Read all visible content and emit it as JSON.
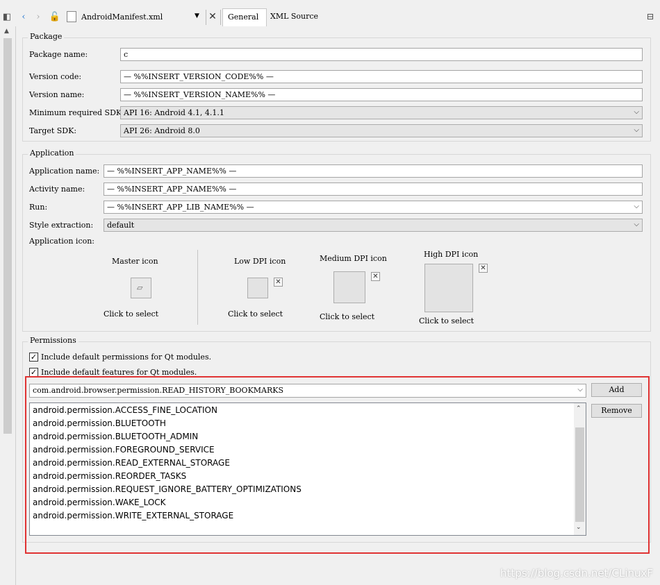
{
  "toolbar": {
    "file_name": "AndroidManifest.xml",
    "tabs": [
      "General",
      "XML Source"
    ]
  },
  "package": {
    "legend": "Package",
    "package_name_label": "Package name:",
    "package_name_value": "c",
    "version_code_label": "Version code:",
    "version_code_value": "— %%INSERT_VERSION_CODE%% —",
    "version_name_label": "Version name:",
    "version_name_value": "— %%INSERT_VERSION_NAME%% —",
    "min_sdk_label": "Minimum required SDK:",
    "min_sdk_value": "API 16: Android 4.1, 4.1.1",
    "target_sdk_label": "Target SDK:",
    "target_sdk_value": "API 26: Android 8.0"
  },
  "application": {
    "legend": "Application",
    "app_name_label": "Application name:",
    "app_name_value": "— %%INSERT_APP_NAME%% —",
    "activity_name_label": "Activity name:",
    "activity_name_value": "— %%INSERT_APP_NAME%% —",
    "run_label": "Run:",
    "run_value": "— %%INSERT_APP_LIB_NAME%% —",
    "style_label": "Style extraction:",
    "style_value": "default",
    "icon_label": "Application icon:",
    "icons": {
      "master": "Master icon",
      "low": "Low DPI icon",
      "medium": "Medium DPI icon",
      "high": "High DPI icon",
      "click": "Click to select"
    }
  },
  "permissions": {
    "legend": "Permissions",
    "include_permissions": "Include default permissions for Qt modules.",
    "include_features": "Include default features for Qt modules.",
    "combo_value": "com.android.browser.permission.READ_HISTORY_BOOKMARKS",
    "add_label": "Add",
    "remove_label": "Remove",
    "items": [
      "android.permission.ACCESS_FINE_LOCATION",
      "android.permission.BLUETOOTH",
      "android.permission.BLUETOOTH_ADMIN",
      "android.permission.FOREGROUND_SERVICE",
      "android.permission.READ_EXTERNAL_STORAGE",
      "android.permission.REORDER_TASKS",
      "android.permission.REQUEST_IGNORE_BATTERY_OPTIMIZATIONS",
      "android.permission.WAKE_LOCK",
      "android.permission.WRITE_EXTERNAL_STORAGE"
    ]
  },
  "watermark": "https://blog.csdn.net/CLinuxF",
  "colors": {
    "highlight_border": "#e03333"
  }
}
